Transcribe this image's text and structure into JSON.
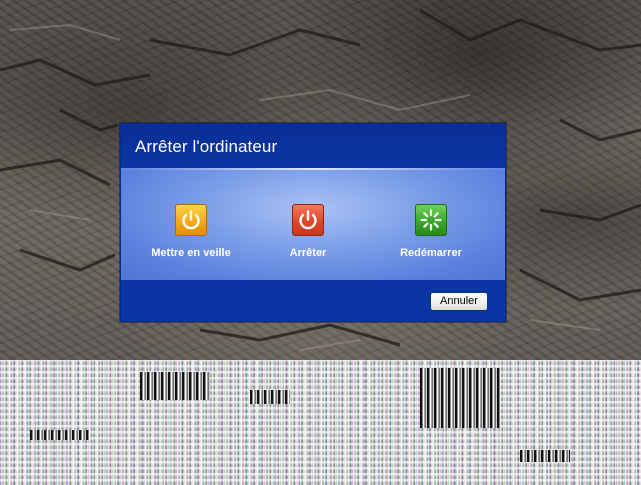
{
  "dialog": {
    "title": "Arrêter l'ordinateur",
    "options": [
      {
        "label": "Mettre en veille",
        "icon": "power-standby-icon",
        "color": "#f3a91b"
      },
      {
        "label": "Arrêter",
        "icon": "power-off-icon",
        "color": "#e0462a"
      },
      {
        "label": "Redémarrer",
        "icon": "restart-icon",
        "color": "#3aa72a"
      }
    ],
    "cancel_label": "Annuler"
  },
  "colors": {
    "header": "#0b34a3",
    "body_center": "#a9c3f4",
    "footer": "#0b35a5"
  }
}
